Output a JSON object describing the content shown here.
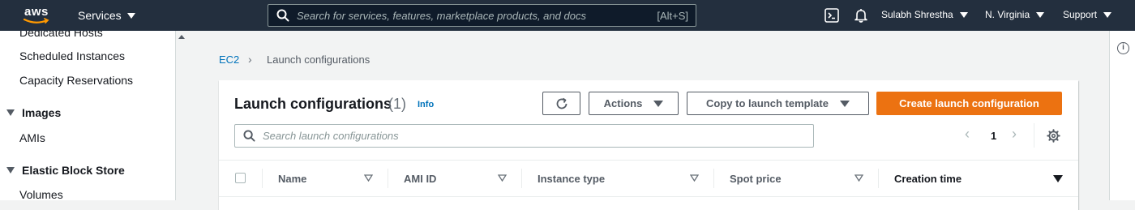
{
  "topnav": {
    "logo_text": "aws",
    "services_label": "Services",
    "search_placeholder": "Search for services, features, marketplace products, and docs",
    "search_shortcut": "[Alt+S]",
    "user_label": "Sulabh Shrestha",
    "region_label": "N. Virginia",
    "support_label": "Support",
    "icons": [
      "cloudshell-icon",
      "bell-icon"
    ]
  },
  "sidebar": {
    "items": [
      {
        "label": "Dedicated Hosts",
        "type": "link"
      },
      {
        "label": "Scheduled Instances",
        "type": "link"
      },
      {
        "label": "Capacity Reservations",
        "type": "link"
      },
      {
        "label": "Images",
        "type": "section"
      },
      {
        "label": "AMIs",
        "type": "link"
      },
      {
        "label": "Elastic Block Store",
        "type": "section"
      },
      {
        "label": "Volumes",
        "type": "link"
      }
    ]
  },
  "breadcrumb": {
    "root": "EC2",
    "current": "Launch configurations"
  },
  "panel": {
    "title": "Launch configurations",
    "count": "(1)",
    "info_link": "Info",
    "actions_label": "Actions",
    "copy_label": "Copy to launch template",
    "create_label": "Create launch configuration",
    "filter_placeholder": "Search launch configurations",
    "page_number": "1"
  },
  "table": {
    "columns": [
      "Name",
      "AMI ID",
      "Instance type",
      "Spot price",
      "Creation time"
    ],
    "sorted_column": "Creation time"
  },
  "colors": {
    "nav_bg": "#232f3e",
    "accent_orange": "#ec7211",
    "link_blue": "#0073bb",
    "page_bg": "#f2f3f3"
  }
}
